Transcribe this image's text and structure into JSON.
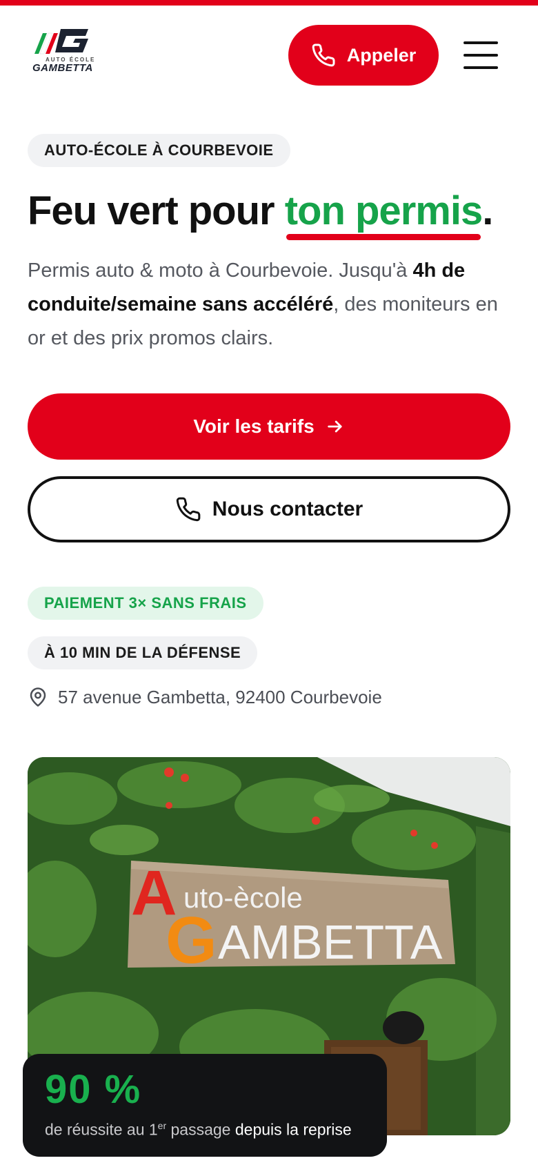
{
  "header": {
    "logo_sub": "AUTO ÉCOLE",
    "logo_name": "GAMBETTA",
    "call_label": "Appeler"
  },
  "hero": {
    "eyebrow": "AUTO-ÉCOLE À COURBEVOIE",
    "title_start": "Feu vert pour ",
    "title_highlight": "ton permis",
    "title_end": ".",
    "lead_part1": "Permis auto & moto à Courbevoie. Jusqu'à ",
    "lead_bold": "4h de conduite/semaine sans accéléré",
    "lead_part2": ", des moniteurs en or et des prix promos clairs.",
    "primary_cta": "Voir les tarifs",
    "secondary_cta": "Nous contacter",
    "badge_payment": "PAIEMENT 3× SANS FRAIS",
    "badge_location": "À 10 MIN DE LA DÉFENSE",
    "address": "57 avenue Gambetta, 92400 Courbevoie"
  },
  "photo": {
    "sign_line1": "Auto-ècole",
    "sign_line2": "GAMBETTA"
  },
  "stat": {
    "value": "90 %",
    "caption_pre": "de réussite au 1",
    "caption_sup": "er",
    "caption_mid": " passage ",
    "caption_strong": "depuis la reprise"
  },
  "colors": {
    "brand_red": "#e2001a",
    "brand_green": "#16a34a",
    "dark": "#121315"
  },
  "icons": [
    "phone-icon",
    "menu-icon",
    "arrow-right-icon",
    "map-pin-icon",
    "logo-icon"
  ]
}
